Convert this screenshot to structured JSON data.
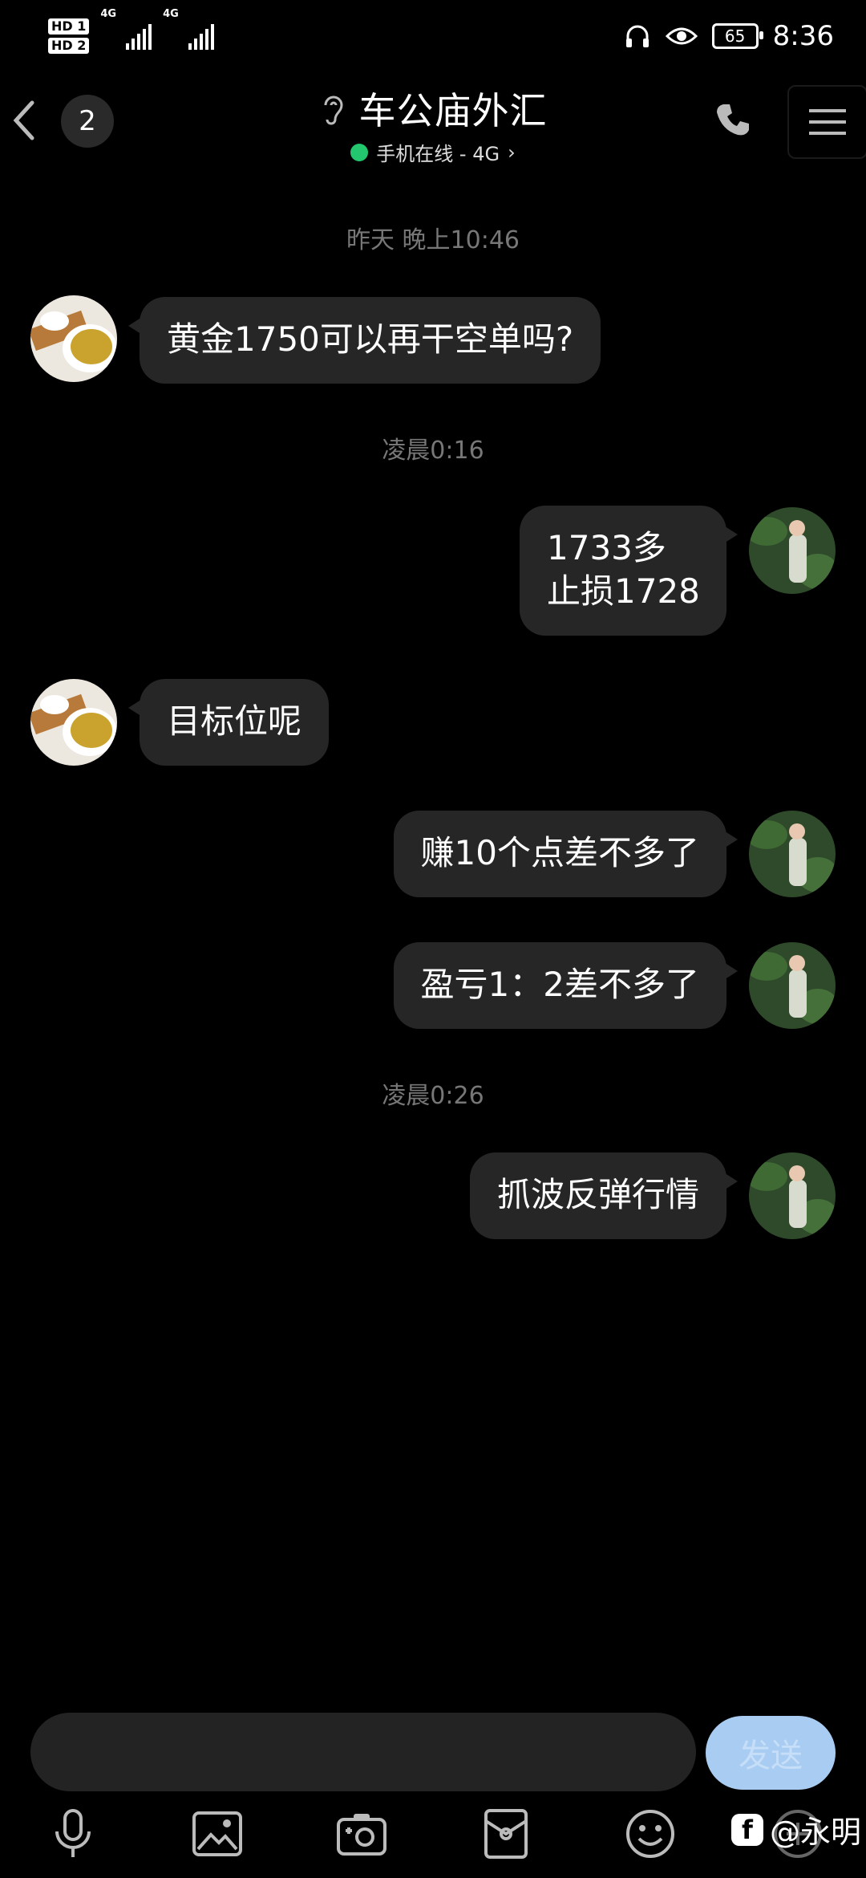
{
  "status_bar": {
    "sim1": "HD 1",
    "sim2": "HD 2",
    "network1": "4G",
    "network2": "4G",
    "battery": "65",
    "time": "8:36"
  },
  "header": {
    "unread_count": "2",
    "title": "车公庙外汇",
    "status_text": "手机在线 - 4G",
    "status_color": "#22c76e"
  },
  "messages": [
    {
      "type": "timestamp",
      "text": "昨天 晚上10:46"
    },
    {
      "type": "incoming",
      "lines": [
        "黄金1750可以再干空单吗?"
      ]
    },
    {
      "type": "timestamp",
      "text": "凌晨0:16"
    },
    {
      "type": "outgoing",
      "lines": [
        "1733多",
        "止损1728"
      ]
    },
    {
      "type": "incoming",
      "lines": [
        "目标位呢"
      ]
    },
    {
      "type": "outgoing",
      "lines": [
        "赚10个点差不多了"
      ]
    },
    {
      "type": "outgoing",
      "lines": [
        "盈亏1：2差不多了"
      ]
    },
    {
      "type": "timestamp",
      "text": "凌晨0:26"
    },
    {
      "type": "outgoing",
      "lines": [
        "抓波反弹行情"
      ]
    }
  ],
  "composer": {
    "input_value": "",
    "send_label": "发送",
    "send_color": "#a9cdf2"
  },
  "toolbar": {
    "icons": [
      "microphone-icon",
      "image-icon",
      "camera-icon",
      "red-packet-icon",
      "emoji-icon",
      "more-icon"
    ]
  },
  "watermark": {
    "text": "@永明"
  }
}
